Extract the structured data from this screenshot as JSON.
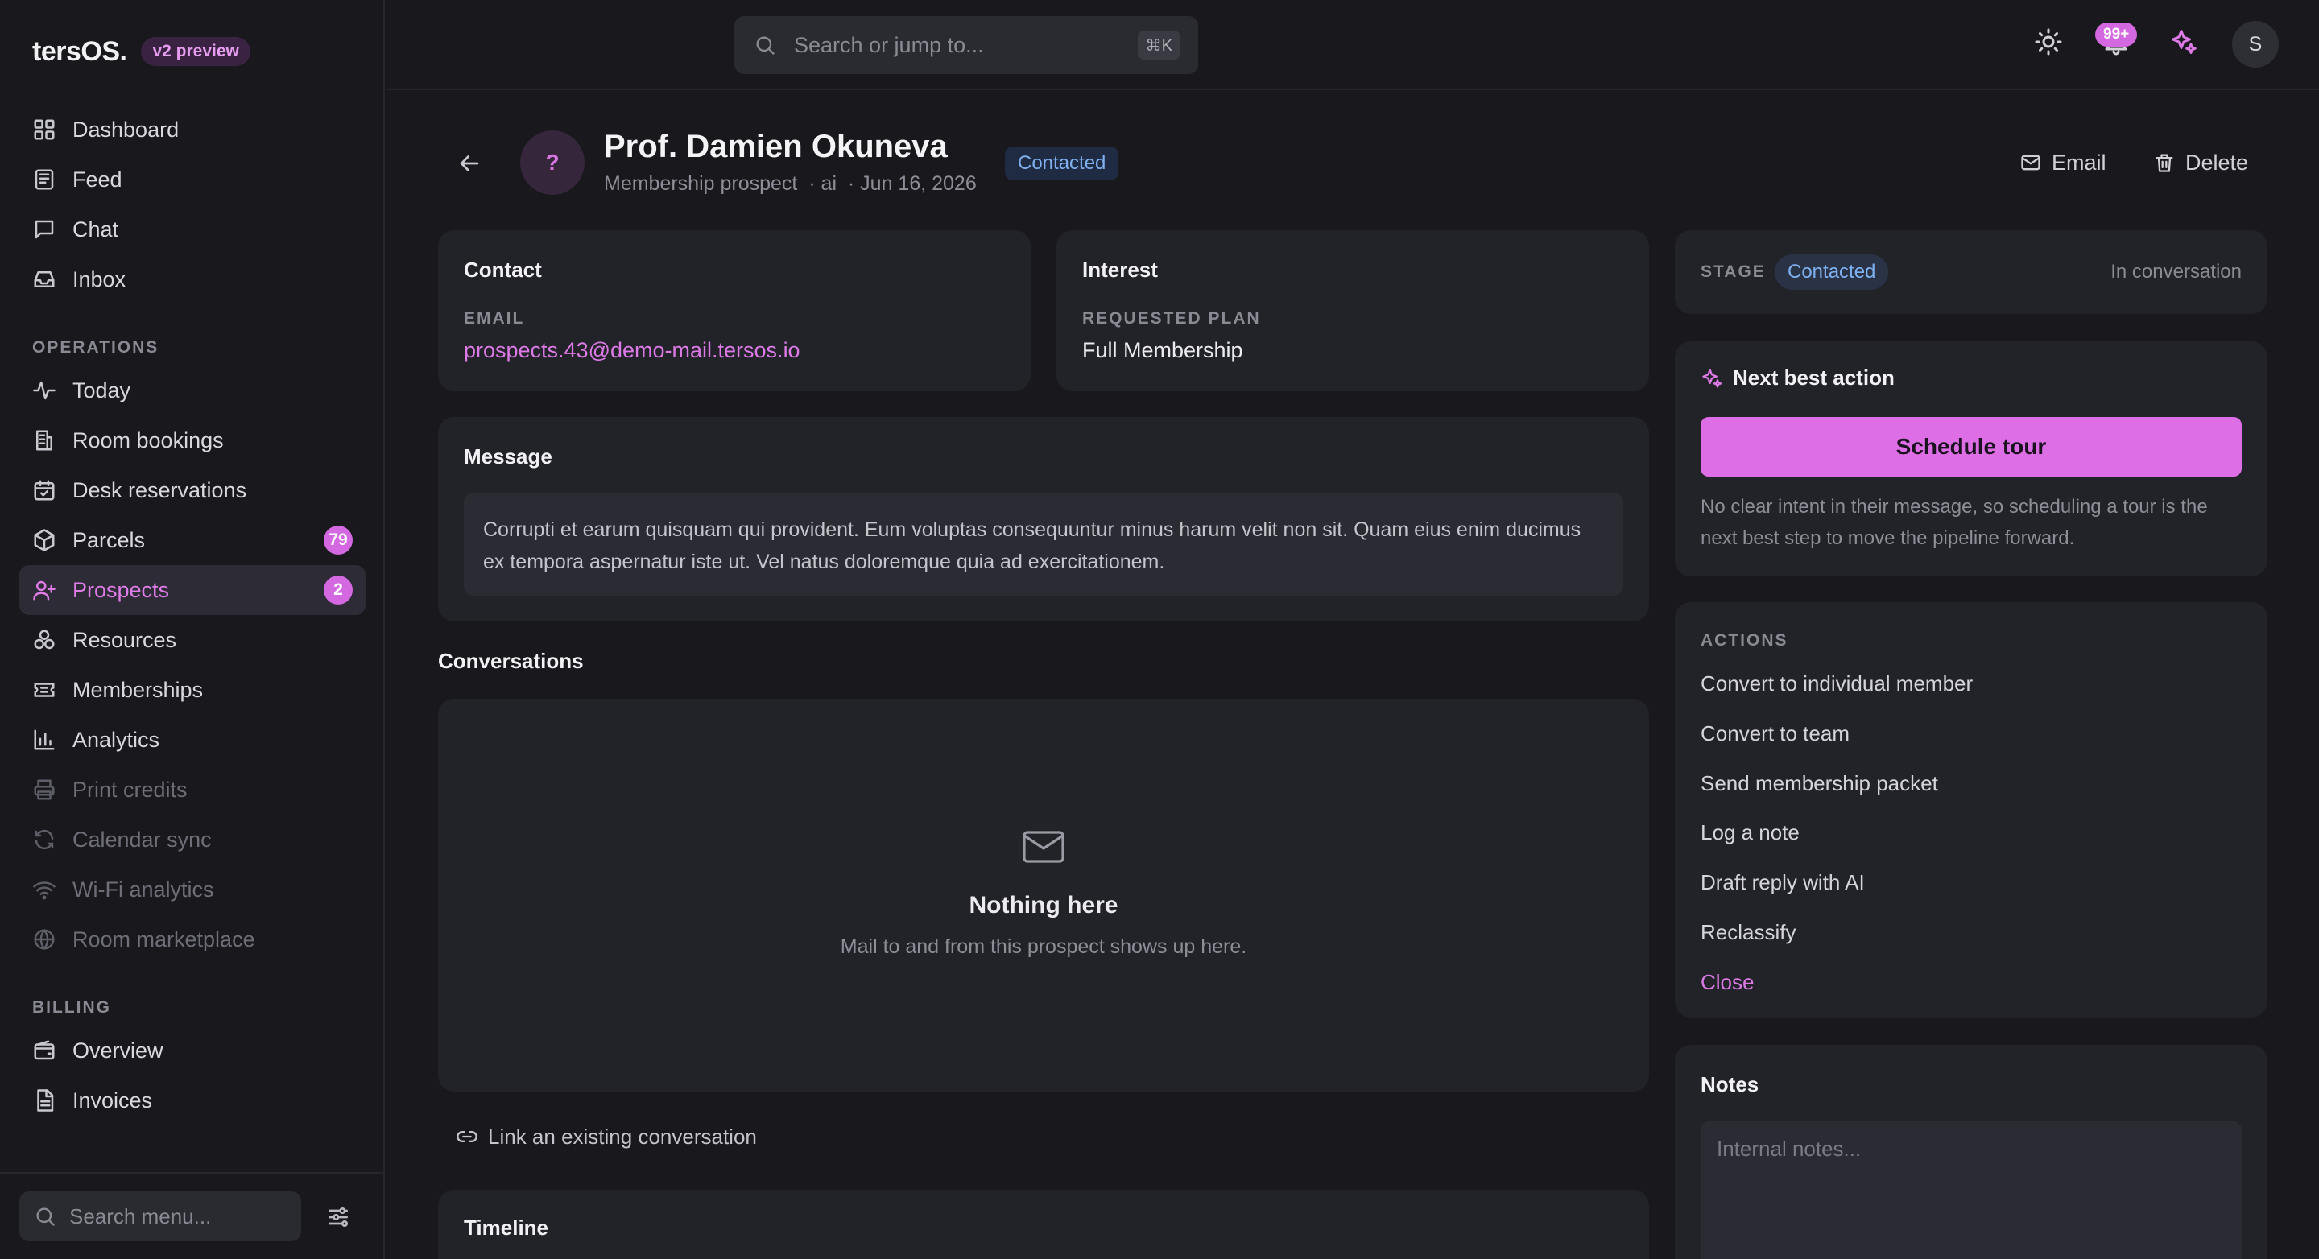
{
  "app": {
    "brand": "tersOS.",
    "badge": "v2 preview"
  },
  "sidebar": {
    "main": [
      {
        "label": "Dashboard",
        "icon": "grid-icon"
      },
      {
        "label": "Feed",
        "icon": "newspaper-icon"
      },
      {
        "label": "Chat",
        "icon": "chat-icon"
      },
      {
        "label": "Inbox",
        "icon": "inbox-icon"
      }
    ],
    "operations_heading": "OPERATIONS",
    "operations": [
      {
        "label": "Today",
        "icon": "activity-icon"
      },
      {
        "label": "Room bookings",
        "icon": "building-icon"
      },
      {
        "label": "Desk reservations",
        "icon": "calendar-check-icon"
      },
      {
        "label": "Parcels",
        "icon": "package-icon",
        "badge": "79"
      },
      {
        "label": "Prospects",
        "icon": "user-plus-icon",
        "badge": "2",
        "active": true
      },
      {
        "label": "Resources",
        "icon": "resources-icon"
      },
      {
        "label": "Memberships",
        "icon": "ticket-icon"
      },
      {
        "label": "Analytics",
        "icon": "bar-chart-icon"
      },
      {
        "label": "Print credits",
        "icon": "printer-icon",
        "disabled": true
      },
      {
        "label": "Calendar sync",
        "icon": "refresh-icon",
        "disabled": true
      },
      {
        "label": "Wi-Fi analytics",
        "icon": "wifi-icon",
        "disabled": true
      },
      {
        "label": "Room marketplace",
        "icon": "globe-icon",
        "disabled": true
      }
    ],
    "billing_heading": "BILLING",
    "billing": [
      {
        "label": "Overview",
        "icon": "wallet-icon"
      },
      {
        "label": "Invoices",
        "icon": "file-text-icon"
      }
    ],
    "search_placeholder": "Search menu..."
  },
  "topbar": {
    "search_placeholder": "Search or jump to...",
    "shortcut": "⌘K",
    "notifications_count": "99+",
    "avatar_initial": "S"
  },
  "prospect": {
    "avatar": "?",
    "name": "Prof. Damien Okuneva",
    "meta": "Membership prospect  · ai  · Jun 16, 2026",
    "status": "Contacted",
    "email_action": "Email",
    "delete_action": "Delete"
  },
  "contact": {
    "title": "Contact",
    "email_label": "EMAIL",
    "email": "prospects.43@demo-mail.tersos.io"
  },
  "interest": {
    "title": "Interest",
    "plan_label": "REQUESTED PLAN",
    "plan": "Full Membership"
  },
  "message": {
    "title": "Message",
    "body": "Corrupti et earum quisquam qui provident. Eum voluptas consequuntur minus harum velit non sit. Quam eius enim ducimus ex tempora aspernatur iste ut. Vel natus doloremque quia ad exercitationem."
  },
  "conversations": {
    "title": "Conversations",
    "empty_title": "Nothing here",
    "empty_sub": "Mail to and from this prospect shows up here.",
    "link_label": "Link an existing conversation"
  },
  "timeline": {
    "title": "Timeline"
  },
  "stage": {
    "label": "STAGE",
    "value": "Contacted",
    "note": "In conversation"
  },
  "next_best_action": {
    "title": "Next best action",
    "button": "Schedule tour",
    "description": "No clear intent in their message, so scheduling a tour is the next best step to move the pipeline forward."
  },
  "actions": {
    "heading": "ACTIONS",
    "items": [
      "Convert to individual member",
      "Convert to team",
      "Send membership packet",
      "Log a note",
      "Draft reply with AI",
      "Reclassify",
      "Close"
    ]
  },
  "notes": {
    "title": "Notes",
    "placeholder": "Internal notes..."
  },
  "colors": {
    "accent": "#de6ee6",
    "status_blue": "#7fb0f0",
    "background": "#18181d",
    "card": "#222229"
  }
}
